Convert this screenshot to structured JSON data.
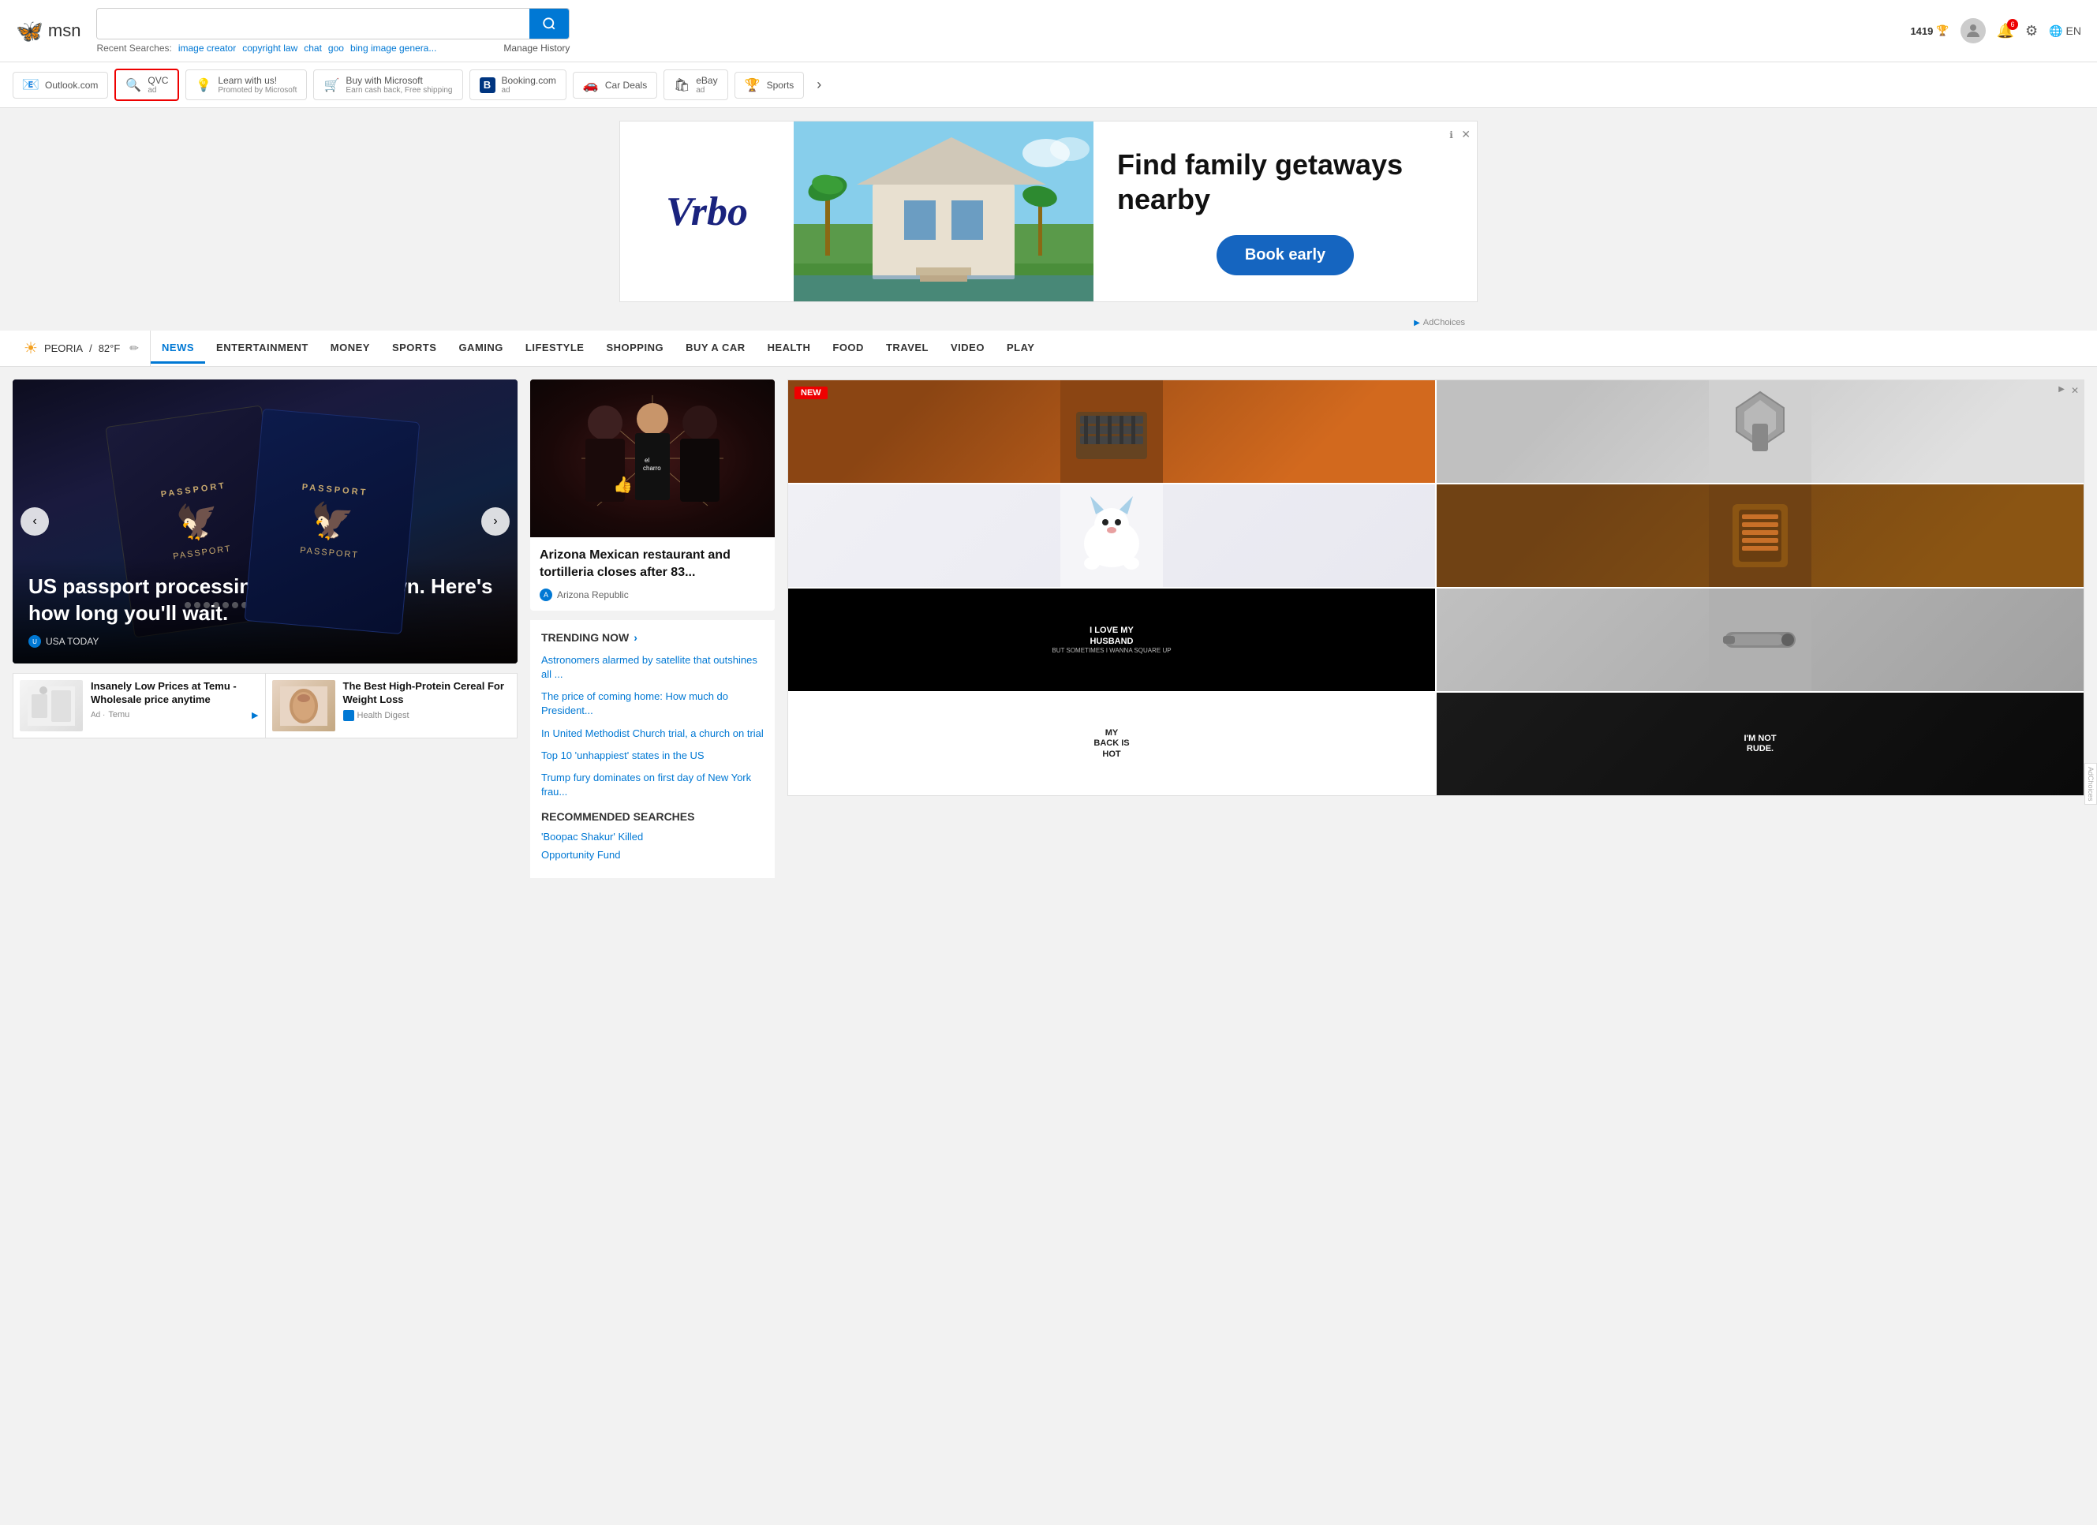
{
  "header": {
    "logo_text": "msn",
    "search_placeholder": "",
    "search_value": "",
    "recent_label": "Recent Searches:",
    "recent_items": [
      "image creator",
      "copyright law",
      "chat",
      "goo",
      "bing image genera..."
    ],
    "manage_history": "Manage History",
    "points": "1419",
    "lang": "EN"
  },
  "shortcuts": [
    {
      "id": "outlook",
      "label": "Outlook.com",
      "icon": "📧",
      "ad": false
    },
    {
      "id": "qvc",
      "label": "QVC",
      "icon": "🔍",
      "ad": true
    },
    {
      "id": "learn",
      "label": "Learn with us!",
      "sublabel": "Promoted by Microsoft",
      "icon": "💡",
      "ad": false
    },
    {
      "id": "microsoft",
      "label": "Buy with Microsoft",
      "sublabel": "Earn cash back, Free shipping",
      "icon": "🛒",
      "ad": false
    },
    {
      "id": "booking",
      "label": "Booking.com",
      "icon": "🅱",
      "ad": true
    },
    {
      "id": "cardeals",
      "label": "Car Deals",
      "icon": "🚗",
      "ad": false
    },
    {
      "id": "ebay",
      "label": "eBay",
      "icon": "🛍",
      "ad": true
    },
    {
      "id": "sports",
      "label": "Sports",
      "icon": "🏆",
      "ad": false
    }
  ],
  "ad_banner": {
    "logo": "Vrbo",
    "tagline": "Find family getaways nearby",
    "cta": "Book early",
    "ad_choices_text": "AdChoices"
  },
  "category_nav": {
    "weather_location": "PEORIA",
    "weather_temp": "82°F",
    "items": [
      "NEWS",
      "ENTERTAINMENT",
      "MONEY",
      "SPORTS",
      "GAMING",
      "LIFESTYLE",
      "SHOPPING",
      "BUY A CAR",
      "HEALTH",
      "FOOD",
      "TRAVEL",
      "VIDEO",
      "PLAY"
    ]
  },
  "hero": {
    "title": "US passport processing times are down. Here's how long you'll wait.",
    "source": "USA TODAY",
    "prev_label": "‹",
    "next_label": "›"
  },
  "sub_cards": [
    {
      "title": "Insanely Low Prices at Temu - Wholesale price anytime",
      "source": "Temu",
      "is_ad": true
    },
    {
      "title": "The Best High-Protein Cereal For Weight Loss",
      "source": "Health Digest",
      "is_ad": false
    }
  ],
  "middle": {
    "top_story": {
      "title": "Arizona Mexican restaurant and tortilleria closes after 83...",
      "source": "Arizona Republic"
    },
    "trending": {
      "header": "TRENDING NOW",
      "items": [
        "Astronomers alarmed by satellite that outshines all ...",
        "The price of coming home: How much do President...",
        "In United Methodist Church trial, a church on trial",
        "Top 10 'unhappiest' states in the US",
        "Trump fury dominates on first day of New York frau..."
      ]
    },
    "recommended": {
      "header": "RECOMMENDED SEARCHES",
      "items": [
        "'Boopac Shakur' Killed",
        "Opportunity Fund"
      ]
    }
  },
  "right_ad": {
    "badge": "NEW",
    "ad_choices": "AdChoices",
    "sidebar_label": "AdChoices"
  },
  "shirt_cells": {
    "cell5_line1": "I LOVE MY",
    "cell5_line2": "HUSBAND",
    "cell5_sub": "BUT SOMETIMES I WANNA SQUARE UP",
    "cell7_line1": "MY",
    "cell7_line2": "BACK IS",
    "cell7_line3": "HOT",
    "cell8_line1": "I'M NOT",
    "cell8_line2": "RUDE."
  }
}
